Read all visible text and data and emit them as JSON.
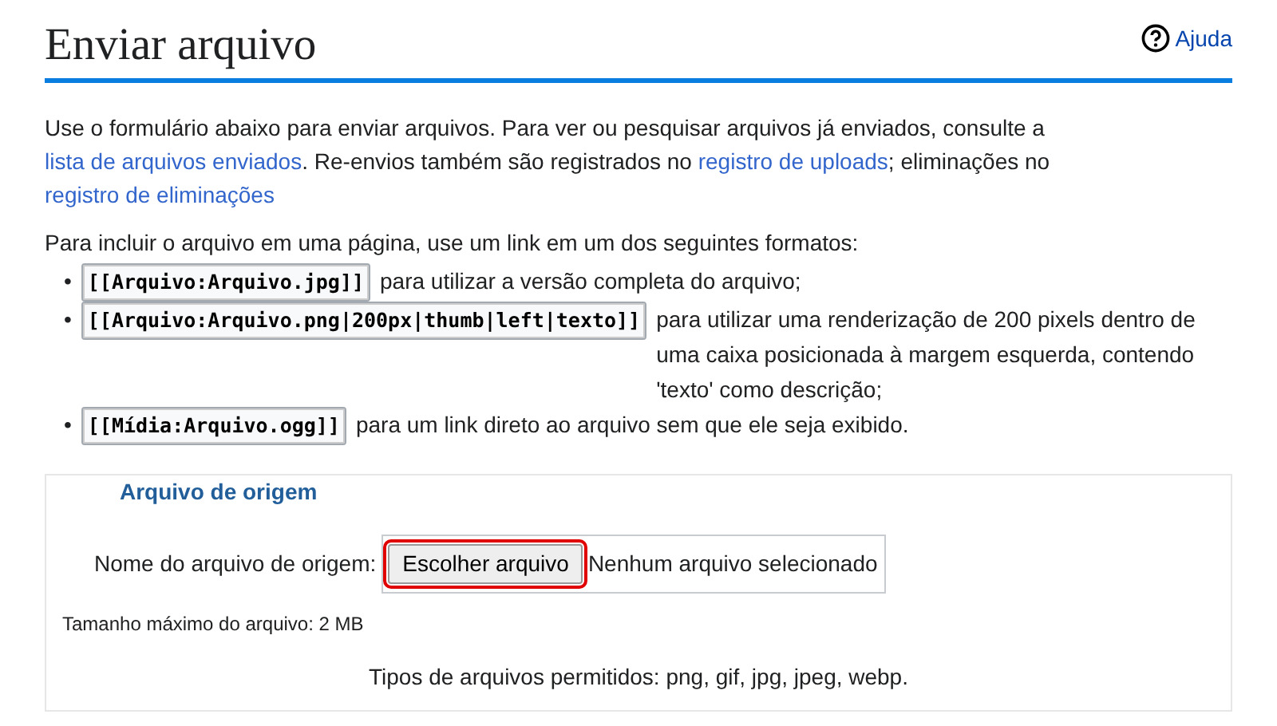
{
  "page": {
    "title": "Enviar arquivo",
    "help_link": "Ajuda"
  },
  "intro": [
    {
      "kind": "text",
      "text": "Use o formulário abaixo para enviar arquivos. Para ver ou pesquisar arquivos já enviados, consulte a"
    },
    {
      "kind": "link",
      "text": "lista de arquivos enviados"
    },
    {
      "kind": "text",
      "text": ". Re-envios também são registrados no"
    },
    {
      "kind": "link",
      "text": "registro de uploads"
    },
    {
      "kind": "text",
      "text": "; eliminações no"
    },
    {
      "kind": "link",
      "text": "registro de eliminações"
    }
  ],
  "formats_intro": "Para incluir o arquivo em uma página, use um link em um dos seguintes formatos:",
  "formats": [
    {
      "marker": "•",
      "code": "[[Arquivo:Arquivo.jpg]]",
      "description": "para utilizar a versão completa do arquivo;"
    },
    {
      "marker": "•",
      "code": "[[Arquivo:Arquivo.png|200px|thumb|left|texto]]",
      "description": "para utilizar uma renderização de 200 pixels dentro de uma caixa posicionada à margem esquerda, contendo 'texto' como descrição;"
    },
    {
      "marker": "•",
      "code": "[[Mídia:Arquivo.ogg]]",
      "description": "para um link direto ao arquivo sem que ele seja exibido."
    }
  ],
  "source_file": {
    "legend": "Arquivo de origem",
    "field_label": "Nome do arquivo de origem:",
    "button": "Escolher arquivo",
    "button_highlighted": true,
    "file_status": "Nenhum arquivo selecionado",
    "max_size": "Tamanho máximo do arquivo: 2 MB",
    "allowed_types": "Tipos de arquivos permitidos: png, gif, jpg, jpeg, webp."
  }
}
